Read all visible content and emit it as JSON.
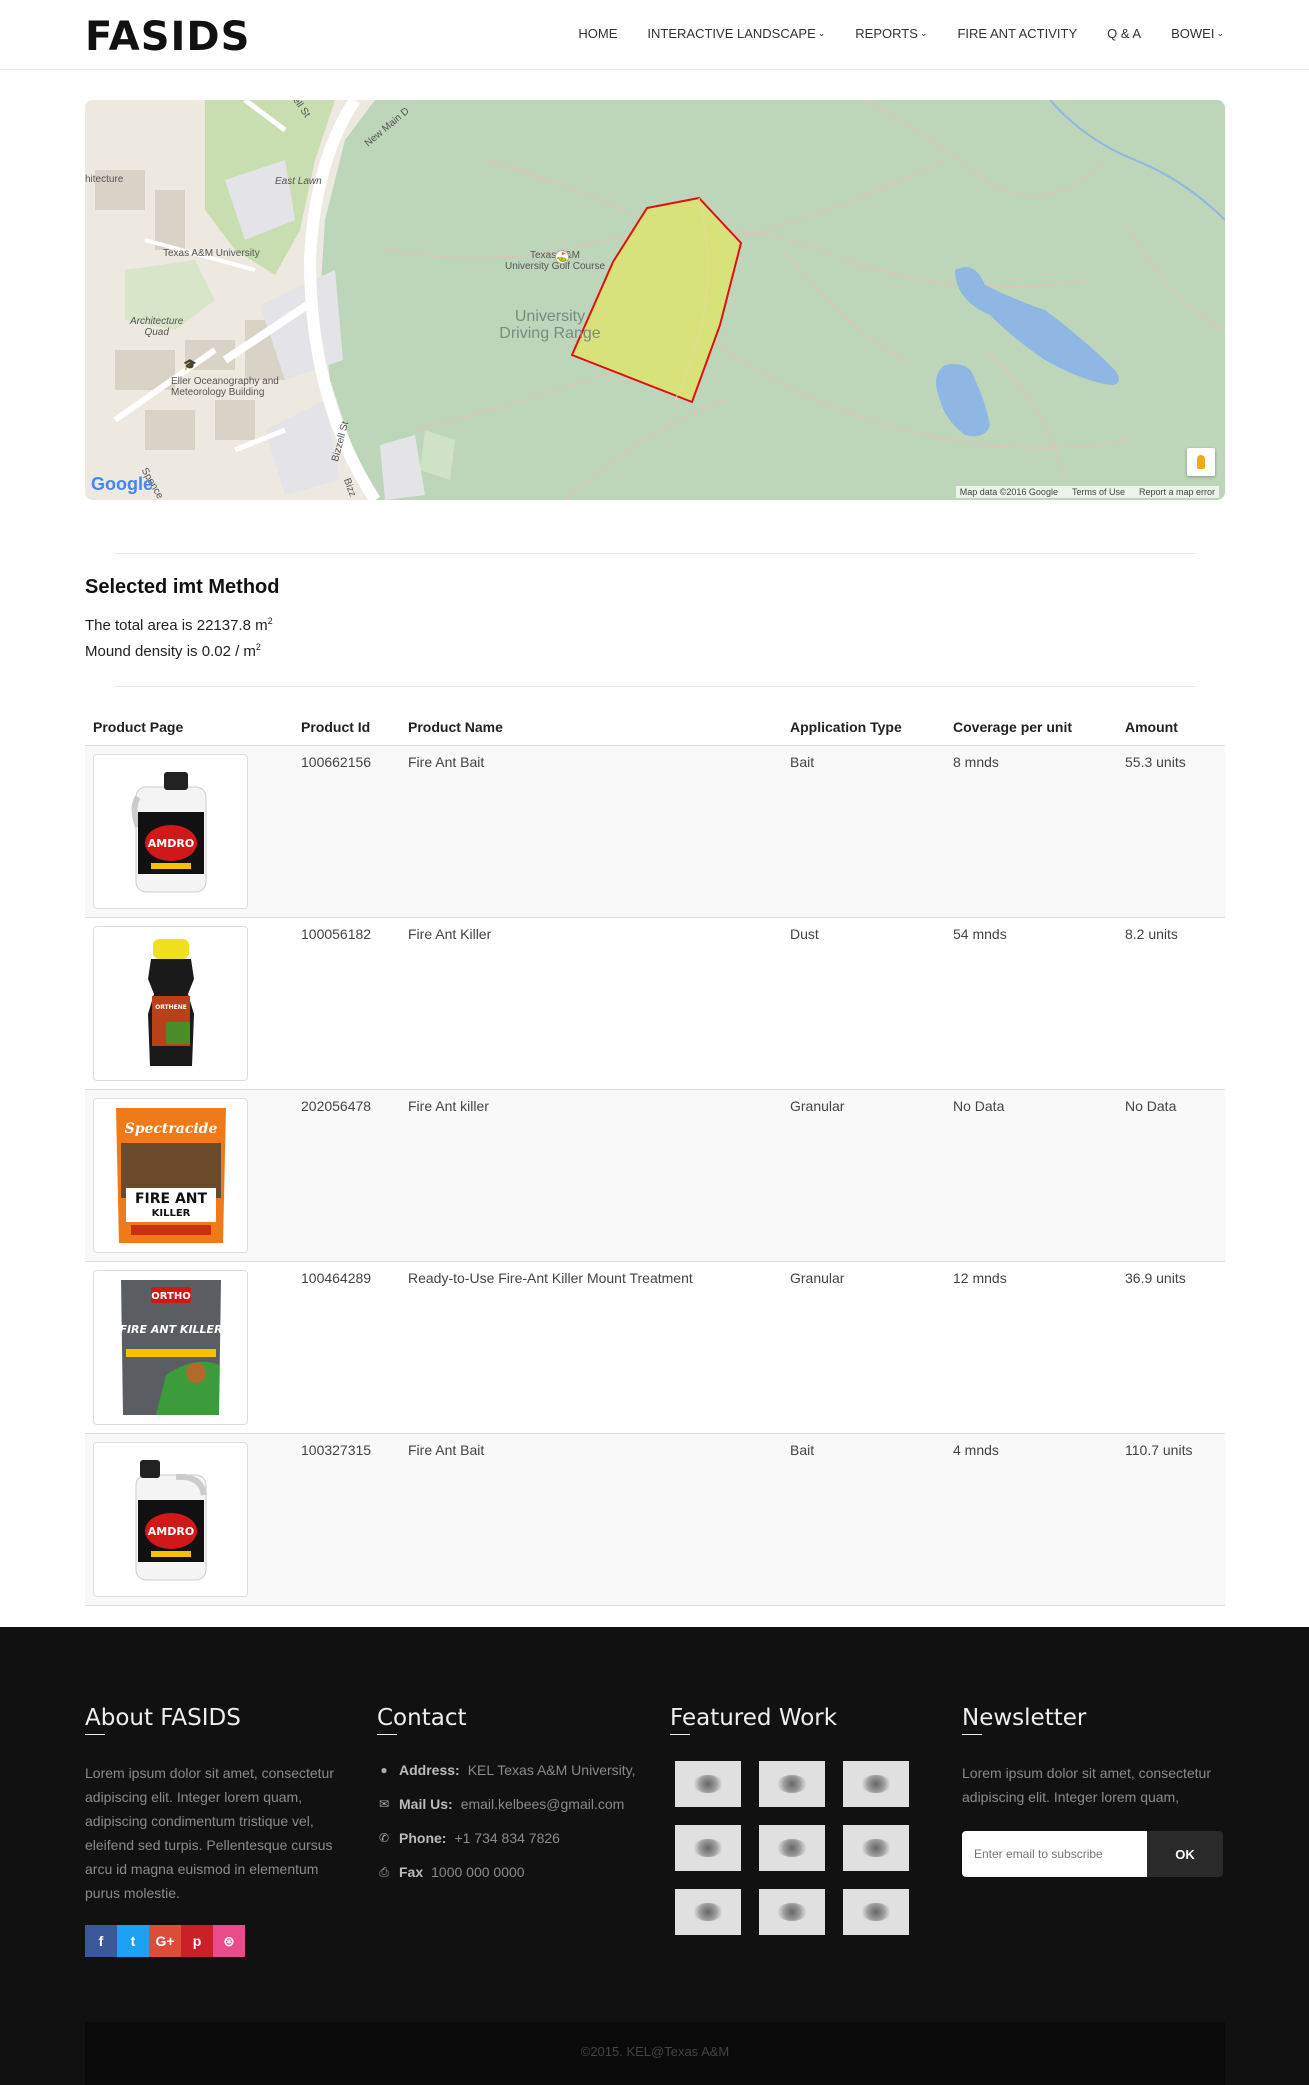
{
  "header": {
    "logo": "FASIDS",
    "nav": [
      {
        "label": "HOME",
        "dropdown": false
      },
      {
        "label": "INTERACTIVE LANDSCAPE",
        "dropdown": true
      },
      {
        "label": "REPORTS",
        "dropdown": true
      },
      {
        "label": "FIRE ANT ACTIVITY",
        "dropdown": false
      },
      {
        "label": "Q & A",
        "dropdown": false
      },
      {
        "label": "BOWEI",
        "dropdown": true
      }
    ]
  },
  "map": {
    "labels": {
      "hitecture": "hitecture",
      "east_lawn": "East Lawn",
      "texas_am": "Texas A&M University",
      "golf_line1": "Texas A&M",
      "golf_line2": "University Golf Course",
      "arch_line1": "Architecture",
      "arch_line2": "Quad",
      "driving_line1": "University",
      "driving_line2": "Driving Range",
      "eller_line1": "Eller Oceanography and",
      "eller_line2": "Meteorology Building",
      "new_main": "New Main D",
      "bizzell": "Bizzell St",
      "ell_st": "ell St",
      "spence": "Spence",
      "bizz": "Bizz"
    },
    "google": "Google",
    "attribution": {
      "data": "Map data ©2016 Google",
      "terms": "Terms of Use",
      "report": "Report a map error"
    },
    "polygon_color": "#e01010",
    "polygon_fill": "#d7e27a"
  },
  "method": {
    "title": "Selected imt Method",
    "area_text": "The total area is 22137.8 m",
    "area_sup": "2",
    "density_text": "Mound density is 0.02 / m",
    "density_sup": "2"
  },
  "table": {
    "headers": [
      "Product Page",
      "Product Id",
      "Product Name",
      "Application Type",
      "Coverage per unit",
      "Amount"
    ],
    "rows": [
      {
        "id": "100662156",
        "name": "Fire Ant Bait",
        "type": "Bait",
        "coverage": "8 mnds",
        "amount": "55.3 units",
        "brand": "AMDRO",
        "image": "amdro-jug"
      },
      {
        "id": "100056182",
        "name": "Fire Ant Killer",
        "type": "Dust",
        "coverage": "54 mnds",
        "amount": "8.2 units",
        "brand": "ORTHENE",
        "image": "ortho-bottle"
      },
      {
        "id": "202056478",
        "name": "Fire Ant killer",
        "type": "Granular",
        "coverage": "No Data",
        "amount": "No Data",
        "brand": "Spectracide",
        "image": "spectracide-bag",
        "brand2": "FIRE ANT",
        "brand3": "KILLER"
      },
      {
        "id": "100464289",
        "name": "Ready-to-Use Fire-Ant Killer Mount Treatment",
        "type": "Granular",
        "coverage": "12 mnds",
        "amount": "36.9 units",
        "brand": "ORTHO",
        "image": "ortho-bag",
        "brand2": "FIRE ANT KILLER"
      },
      {
        "id": "100327315",
        "name": "Fire Ant Bait",
        "type": "Bait",
        "coverage": "4 mnds",
        "amount": "110.7 units",
        "brand": "AMDRO",
        "image": "amdro-jug-2"
      }
    ]
  },
  "footer": {
    "about": {
      "title": "About FASIDS",
      "text": "Lorem ipsum dolor sit amet, consectetur adipiscing elit. Integer lorem quam, adipiscing condimentum tristique vel, eleifend sed turpis. Pellentesque cursus arcu id magna euismod in elementum purus molestie."
    },
    "social": [
      {
        "icon": "facebook-icon",
        "glyph": "f",
        "color": "#3b5998"
      },
      {
        "icon": "twitter-icon",
        "glyph": "t",
        "color": "#1da1f2"
      },
      {
        "icon": "google-plus-icon",
        "glyph": "G+",
        "color": "#dd4b39"
      },
      {
        "icon": "pinterest-icon",
        "glyph": "p",
        "color": "#cb2027"
      },
      {
        "icon": "dribbble-icon",
        "glyph": "⊛",
        "color": "#ea4c89"
      }
    ],
    "contact": {
      "title": "Contact",
      "address_label": "Address:",
      "address": "KEL Texas A&M University,",
      "mail_label": "Mail Us:",
      "mail": "email.kelbees@gmail.com",
      "phone_label": "Phone:",
      "phone": "+1 734 834 7826",
      "fax_label": "Fax",
      "fax": "1000 000 0000"
    },
    "featured": {
      "title": "Featured Work",
      "count": 9
    },
    "newsletter": {
      "title": "Newsletter",
      "text": "Lorem ipsum dolor sit amet, consectetur adipiscing elit. Integer lorem quam,",
      "placeholder": "Enter email to subscribe",
      "button": "OK"
    },
    "copyright": "©2015. KEL@Texas A&M"
  }
}
